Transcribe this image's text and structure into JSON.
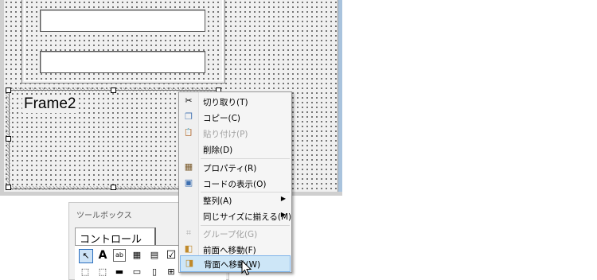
{
  "frame2": {
    "caption": "Frame2"
  },
  "toolbox": {
    "title": "ツールボックス",
    "tab": "コントロール",
    "tools_row1": [
      "↖",
      "A",
      "ab",
      "▦",
      "▤",
      "☑"
    ],
    "tools_row2": [
      "⬚",
      "⬚",
      "▬",
      "▭",
      "▯",
      "⊞"
    ]
  },
  "context_menu": {
    "items": [
      {
        "label": "切り取り(T)",
        "icon": "scissors-icon",
        "glyph": "✂",
        "disabled": false
      },
      {
        "label": "コピー(C)",
        "icon": "copy-icon",
        "glyph": "❐",
        "disabled": false
      },
      {
        "label": "貼り付け(P)",
        "icon": "paste-icon",
        "glyph": "📋",
        "disabled": true
      },
      {
        "label": "削除(D)",
        "icon": "",
        "glyph": "",
        "disabled": false
      },
      {
        "label": "プロパティ(R)",
        "icon": "properties-icon",
        "glyph": "▦",
        "disabled": false
      },
      {
        "label": "コードの表示(O)",
        "icon": "view-code-icon",
        "glyph": "▣",
        "disabled": false
      },
      {
        "label": "整列(A)",
        "icon": "",
        "glyph": "",
        "disabled": false,
        "submenu": true
      },
      {
        "label": "同じサイズに揃える(M)",
        "icon": "",
        "glyph": "",
        "disabled": false,
        "submenu": true
      },
      {
        "label": "グループ化(G)",
        "icon": "group-icon",
        "glyph": "⌗",
        "disabled": true
      },
      {
        "label": "前面へ移動(F)",
        "icon": "bring-to-front-icon",
        "glyph": "◧",
        "disabled": false
      },
      {
        "label": "背面へ移動(W)",
        "icon": "send-to-back-icon",
        "glyph": "◨",
        "disabled": false,
        "highlighted": true
      }
    ]
  },
  "colors": {
    "menu_highlight": "#cde6f7",
    "menu_highlight_border": "#7eb4ea",
    "disabled_text": "#a0a0a0"
  }
}
